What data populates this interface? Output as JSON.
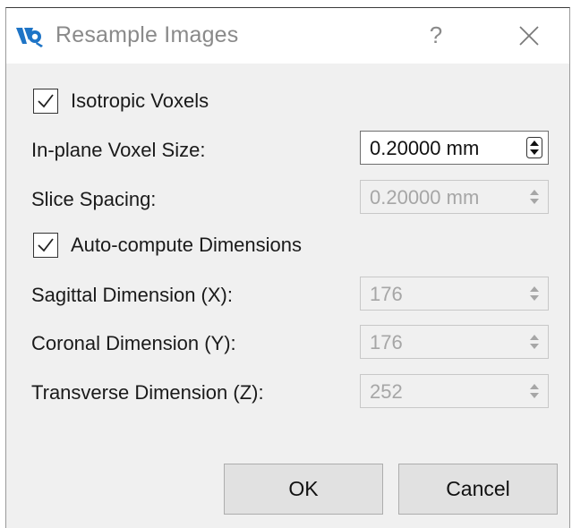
{
  "window": {
    "title": "Resample Images",
    "help_label": "?",
    "logo_icon": "itk-snap-logo"
  },
  "form": {
    "isotropic_label": "Isotropic Voxels",
    "isotropic_checked": true,
    "inplane_label": "In-plane Voxel Size:",
    "inplane_value": "0.20000 mm",
    "slice_label": "Slice Spacing:",
    "slice_value": "0.20000 mm",
    "autocompute_label": "Auto-compute Dimensions",
    "autocompute_checked": true,
    "sagittal_label": "Sagittal Dimension (X):",
    "sagittal_value": "176",
    "coronal_label": "Coronal Dimension (Y):",
    "coronal_value": "176",
    "transverse_label": "Transverse Dimension (Z):",
    "transverse_value": "252"
  },
  "buttons": {
    "ok_label": "OK",
    "cancel_label": "Cancel"
  },
  "colors": {
    "dialog_bg": "#f0f0f0",
    "logo_blue": "#1e74c6",
    "disabled_text": "#a6a6a6"
  }
}
